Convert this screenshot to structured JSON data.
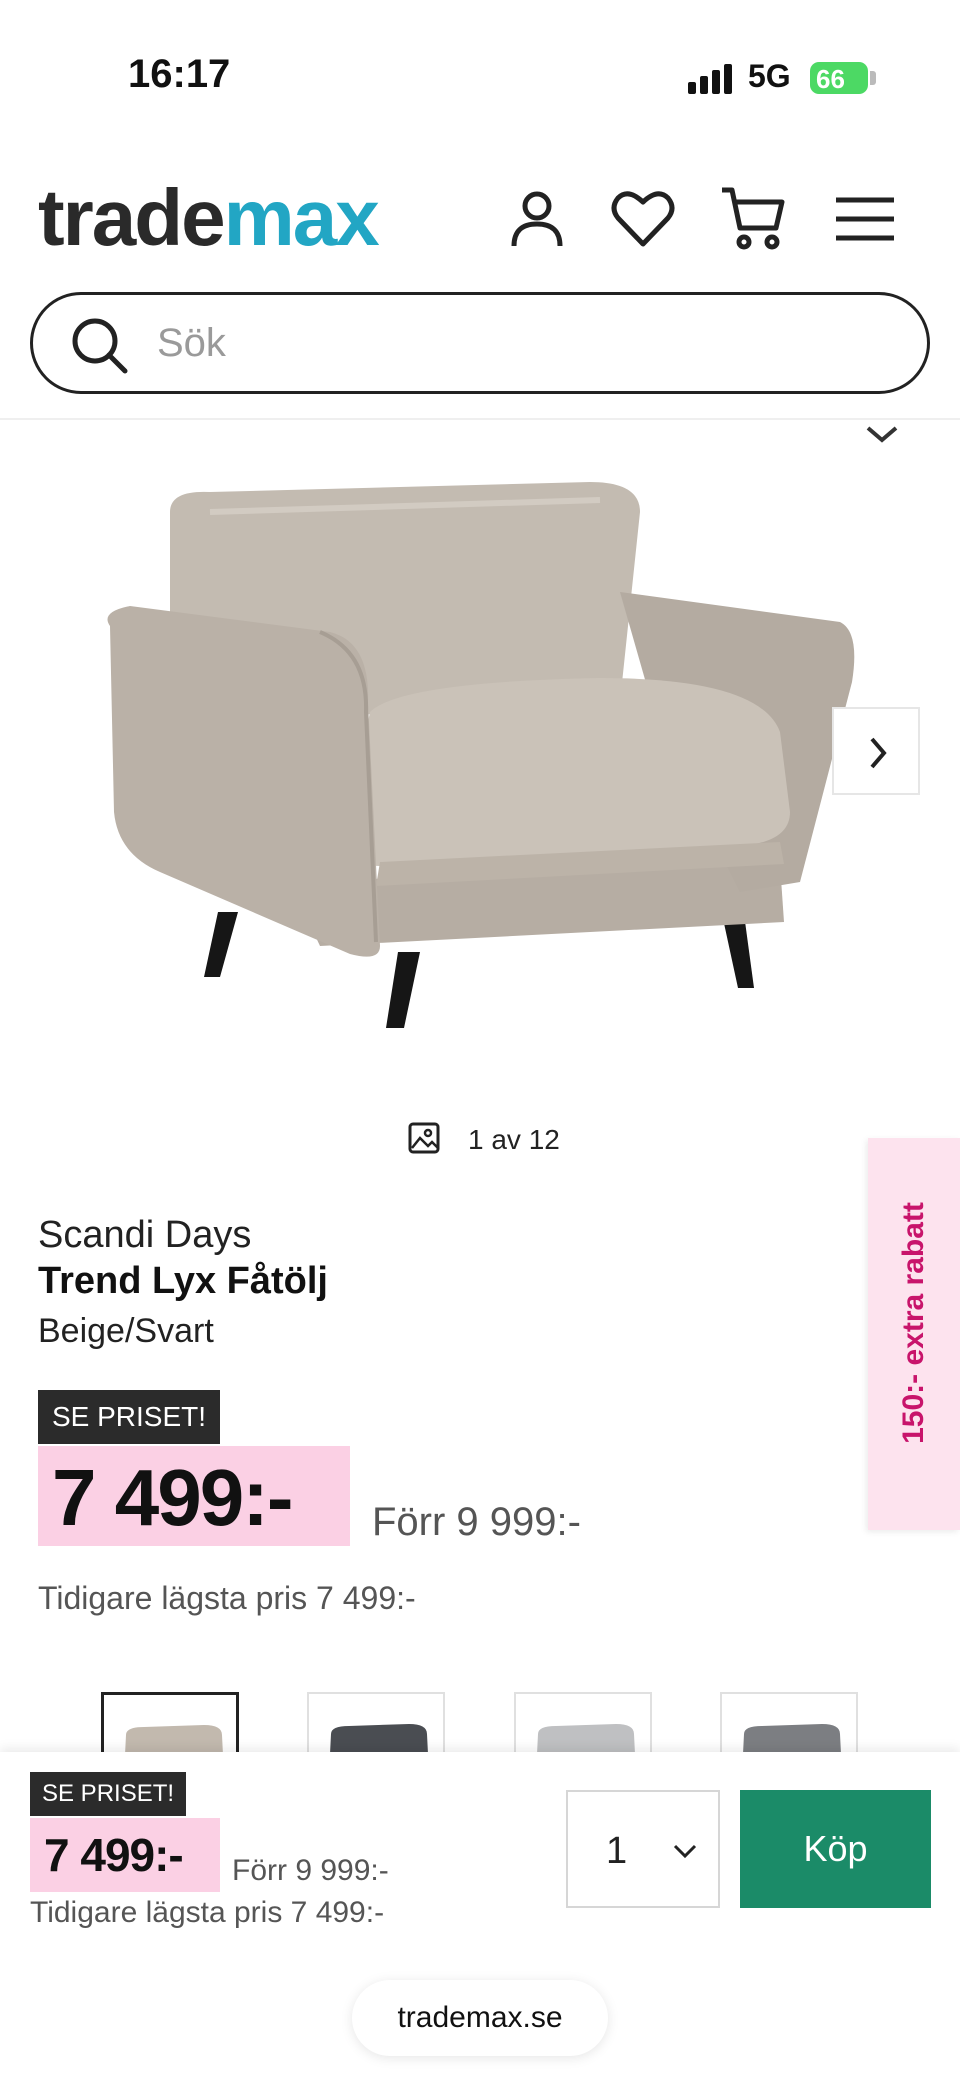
{
  "status_bar": {
    "time": "16:17",
    "network": "5G",
    "battery": "66"
  },
  "header": {
    "logo_part1": "trade",
    "logo_part2": "max",
    "icons": [
      "user-icon",
      "heart-icon",
      "cart-icon",
      "menu-icon"
    ],
    "search": {
      "placeholder": "Sök"
    }
  },
  "gallery": {
    "counter": "1 av 12"
  },
  "product": {
    "brand": "Scandi Days",
    "name": "Trend Lyx Fåtölj",
    "color": "Beige/Svart",
    "badge": "SE PRISET!",
    "price": "7 499:-",
    "was_price": "Förr 9 999:-",
    "lowest_price": "Tidigare lägsta pris 7 499:-"
  },
  "promo_tab": "150:- extra rabatt",
  "variants": [
    "beige",
    "dark-grey",
    "light-grey",
    "grey"
  ],
  "buy_bar": {
    "badge": "SE PRISET!",
    "price": "7 499:-",
    "was_price": "Förr 9 999:-",
    "lowest_price": "Tidigare lägsta pris 7 499:-",
    "quantity": "1",
    "buy_label": "Köp"
  },
  "browser": {
    "url": "trademax.se"
  },
  "colors": {
    "brand_teal": "#22a6c4",
    "price_highlight": "#fbd0e4",
    "promo_text": "#c8146b",
    "buy_button": "#1b8b68"
  }
}
